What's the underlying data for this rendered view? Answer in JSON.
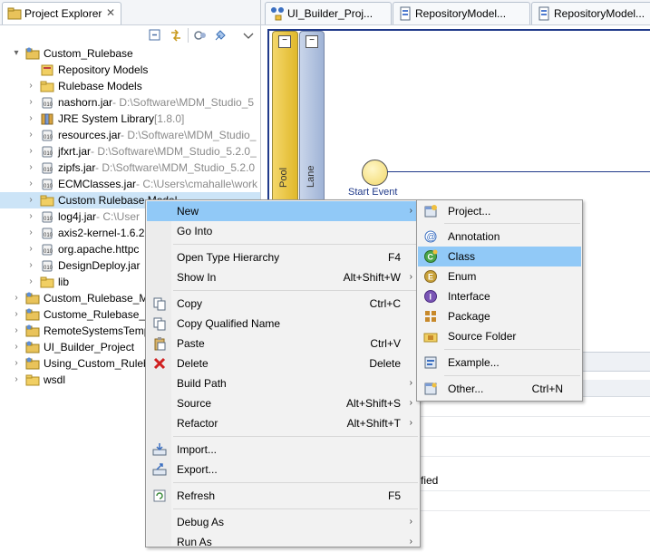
{
  "explorer": {
    "tab_title": "Project Explorer",
    "close_glyph": "✕",
    "tree": [
      {
        "label": "Custom_Rulebase",
        "decoration": "",
        "expanded": true,
        "icon": "project-icon"
      },
      {
        "label": "Repository Models",
        "decoration": "",
        "icon": "models-icon"
      },
      {
        "label": "Rulebase Models",
        "decoration": "",
        "icon": "folder-icon"
      },
      {
        "label": "nashorn.jar",
        "decoration": " - D:\\Software\\MDM_Studio_5",
        "icon": "jar-icon"
      },
      {
        "label": "JRE System Library",
        "decoration": " [1.8.0]",
        "icon": "library-icon"
      },
      {
        "label": "resources.jar",
        "decoration": " - D:\\Software\\MDM_Studio_",
        "icon": "jar-icon"
      },
      {
        "label": "jfxrt.jar",
        "decoration": " - D:\\Software\\MDM_Studio_5.2.0_",
        "icon": "jar-icon"
      },
      {
        "label": "zipfs.jar",
        "decoration": " - D:\\Software\\MDM_Studio_5.2.0",
        "icon": "jar-icon"
      },
      {
        "label": "ECMClasses.jar",
        "decoration": " - C:\\Users\\cmahalle\\work",
        "icon": "jar-icon"
      },
      {
        "label": "Custom Rulebase Model",
        "decoration": "",
        "icon": "folder-icon"
      },
      {
        "label": "log4j.jar",
        "decoration": " - C:\\User",
        "icon": "jar-icon"
      },
      {
        "label": "axis2-kernel-1.6.2",
        "decoration": "",
        "icon": "jar-icon"
      },
      {
        "label": "org.apache.httpc",
        "decoration": "",
        "icon": "jar-icon"
      },
      {
        "label": "DesignDeploy.jar",
        "decoration": "",
        "icon": "jar-icon"
      },
      {
        "label": "lib",
        "decoration": "",
        "icon": "folder-icon"
      },
      {
        "label": "Custom_Rulebase_M",
        "decoration": "",
        "icon": "project-icon"
      },
      {
        "label": "Custome_Rulebase_P",
        "decoration": "",
        "icon": "project-icon"
      },
      {
        "label": "RemoteSystemsTemp",
        "decoration": "",
        "icon": "project-icon"
      },
      {
        "label": "UI_Builder_Project",
        "decoration": "",
        "icon": "project-icon"
      },
      {
        "label": "Using_Custom_Ruleb",
        "decoration": "",
        "icon": "project-icon"
      },
      {
        "label": "wsdl",
        "decoration": "",
        "icon": "folder-icon"
      }
    ]
  },
  "editor": {
    "tabs": [
      {
        "label": "UI_Builder_Proj...",
        "icon": "diagram-icon"
      },
      {
        "label": "RepositoryModel...",
        "icon": "model-icon"
      },
      {
        "label": "RepositoryModel...",
        "icon": "model-icon"
      }
    ],
    "pool_label": "Pool",
    "lane_label": "Lane",
    "start_event_label": "Start Event",
    "fragment_text": "fied",
    "minimize_glyph": "−"
  },
  "context_menu": {
    "items": [
      {
        "label": "New",
        "shortcut": "",
        "submenu": true,
        "icon": ""
      },
      {
        "label": "Go Into",
        "shortcut": "",
        "submenu": false,
        "icon": ""
      },
      {
        "label": "Open Type Hierarchy",
        "shortcut": "F4",
        "submenu": false,
        "icon": ""
      },
      {
        "label": "Show In",
        "shortcut": "Alt+Shift+W",
        "submenu": true,
        "icon": ""
      },
      {
        "label": "Copy",
        "shortcut": "Ctrl+C",
        "submenu": false,
        "icon": "copy-icon"
      },
      {
        "label": "Copy Qualified Name",
        "shortcut": "",
        "submenu": false,
        "icon": "copy-icon"
      },
      {
        "label": "Paste",
        "shortcut": "Ctrl+V",
        "submenu": false,
        "icon": "paste-icon"
      },
      {
        "label": "Delete",
        "shortcut": "Delete",
        "submenu": false,
        "icon": "delete-icon"
      },
      {
        "label": "Build Path",
        "shortcut": "",
        "submenu": true,
        "icon": ""
      },
      {
        "label": "Source",
        "shortcut": "Alt+Shift+S",
        "submenu": true,
        "icon": ""
      },
      {
        "label": "Refactor",
        "shortcut": "Alt+Shift+T",
        "submenu": true,
        "icon": ""
      },
      {
        "label": "Import...",
        "shortcut": "",
        "submenu": false,
        "icon": "import-icon"
      },
      {
        "label": "Export...",
        "shortcut": "",
        "submenu": false,
        "icon": "export-icon"
      },
      {
        "label": "Refresh",
        "shortcut": "F5",
        "submenu": false,
        "icon": "refresh-icon"
      },
      {
        "label": "Debug As",
        "shortcut": "",
        "submenu": true,
        "icon": ""
      },
      {
        "label": "Run As",
        "shortcut": "",
        "submenu": true,
        "icon": ""
      }
    ],
    "submenu_glyph": "›"
  },
  "new_submenu": {
    "items": [
      {
        "label": "Project...",
        "shortcut": "",
        "icon": "project-new-icon"
      },
      {
        "label": "Annotation",
        "shortcut": "",
        "icon": "annotation-icon"
      },
      {
        "label": "Class",
        "shortcut": "",
        "icon": "class-icon"
      },
      {
        "label": "Enum",
        "shortcut": "",
        "icon": "enum-icon"
      },
      {
        "label": "Interface",
        "shortcut": "",
        "icon": "interface-icon"
      },
      {
        "label": "Package",
        "shortcut": "",
        "icon": "package-icon"
      },
      {
        "label": "Source Folder",
        "shortcut": "",
        "icon": "source-folder-icon"
      },
      {
        "label": "Example...",
        "shortcut": "",
        "icon": "example-icon"
      },
      {
        "label": "Other...",
        "shortcut": "Ctrl+N",
        "icon": "other-icon"
      }
    ]
  }
}
